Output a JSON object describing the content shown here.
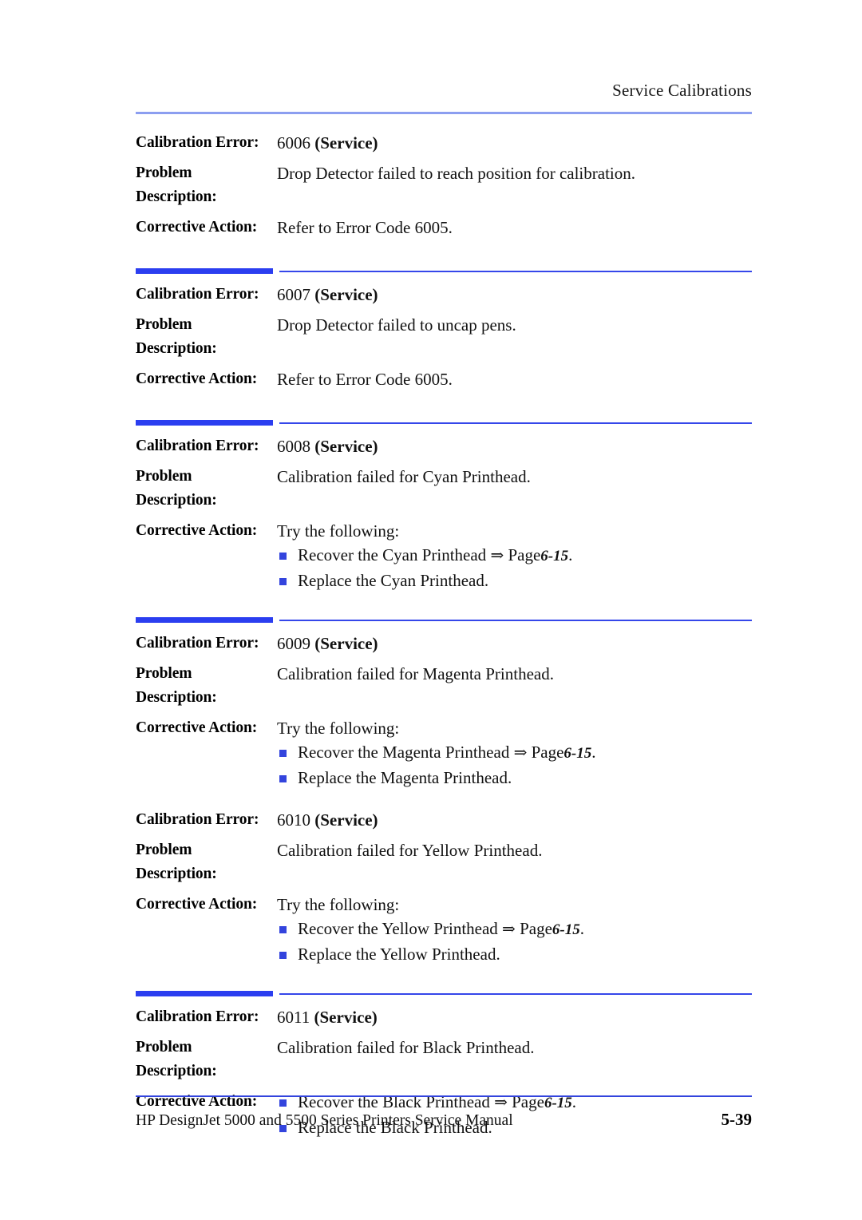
{
  "header": {
    "title": "Service Calibrations"
  },
  "labels": {
    "calibration_error": "Calibration Error:",
    "problem_l1": "Problem",
    "problem_l2": "Description:",
    "corrective_action": "Corrective Action:"
  },
  "entries": [
    {
      "code": "6006",
      "service": "(Service)",
      "problem": "Drop Detector failed to reach position for calibration.",
      "action_text": "Refer to Error Code 6005.",
      "bullets": []
    },
    {
      "code": "6007",
      "service": "(Service)",
      "problem": "Drop Detector failed to uncap pens.",
      "action_text": "Refer to Error Code 6005.",
      "bullets": []
    },
    {
      "code": "6008",
      "service": "(Service)",
      "problem": "Calibration failed for Cyan Printhead.",
      "action_text": "Try the following:",
      "bullets": [
        {
          "text": "Recover the Cyan Printhead",
          "arrow": "⇒",
          "page_word": "Page",
          "page_ref": "6-15",
          "suffix": "."
        },
        {
          "text": "Replace the Cyan Printhead.",
          "arrow": "",
          "page_word": "",
          "page_ref": "",
          "suffix": ""
        }
      ]
    },
    {
      "code": "6009",
      "service": "(Service)",
      "problem": "Calibration failed for Magenta Printhead.",
      "action_text": "Try the following:",
      "bullets": [
        {
          "text": "Recover the Magenta Printhead",
          "arrow": "⇒",
          "page_word": "Page",
          "page_ref": "6-15",
          "suffix": "."
        },
        {
          "text": "Replace the Magenta Printhead.",
          "arrow": "",
          "page_word": "",
          "page_ref": "",
          "suffix": ""
        }
      ]
    },
    {
      "code": "6010",
      "service": "(Service)",
      "problem": "Calibration failed for Yellow Printhead.",
      "action_text": "Try the following:",
      "bullets": [
        {
          "text": "Recover the Yellow Printhead",
          "arrow": "⇒",
          "page_word": "Page",
          "page_ref": "6-15",
          "suffix": "."
        },
        {
          "text": "Replace the Yellow Printhead.",
          "arrow": "",
          "page_word": "",
          "page_ref": "",
          "suffix": ""
        }
      ]
    },
    {
      "code": "6011",
      "service": "(Service)",
      "problem": "Calibration failed for Black Printhead.",
      "action_text": "",
      "bullets": [
        {
          "text": "Recover the Black Printhead",
          "arrow": "⇒",
          "page_word": "Page",
          "page_ref": "6-15",
          "suffix": "."
        },
        {
          "text": "Replace the Black Printhead.",
          "arrow": "",
          "page_word": "",
          "page_ref": "",
          "suffix": ""
        }
      ]
    }
  ],
  "footer": {
    "manual": "HP DesignJet 5000 and 5500 Series Printers Service Manual",
    "page_number": "5-39"
  },
  "colors": {
    "header_rule": "#8c9ef0",
    "divider_thick": "#2b3ef0",
    "divider_thin": "#3547ea",
    "bullet_square": "#3344dd",
    "footer_rule": "#3344dd"
  }
}
